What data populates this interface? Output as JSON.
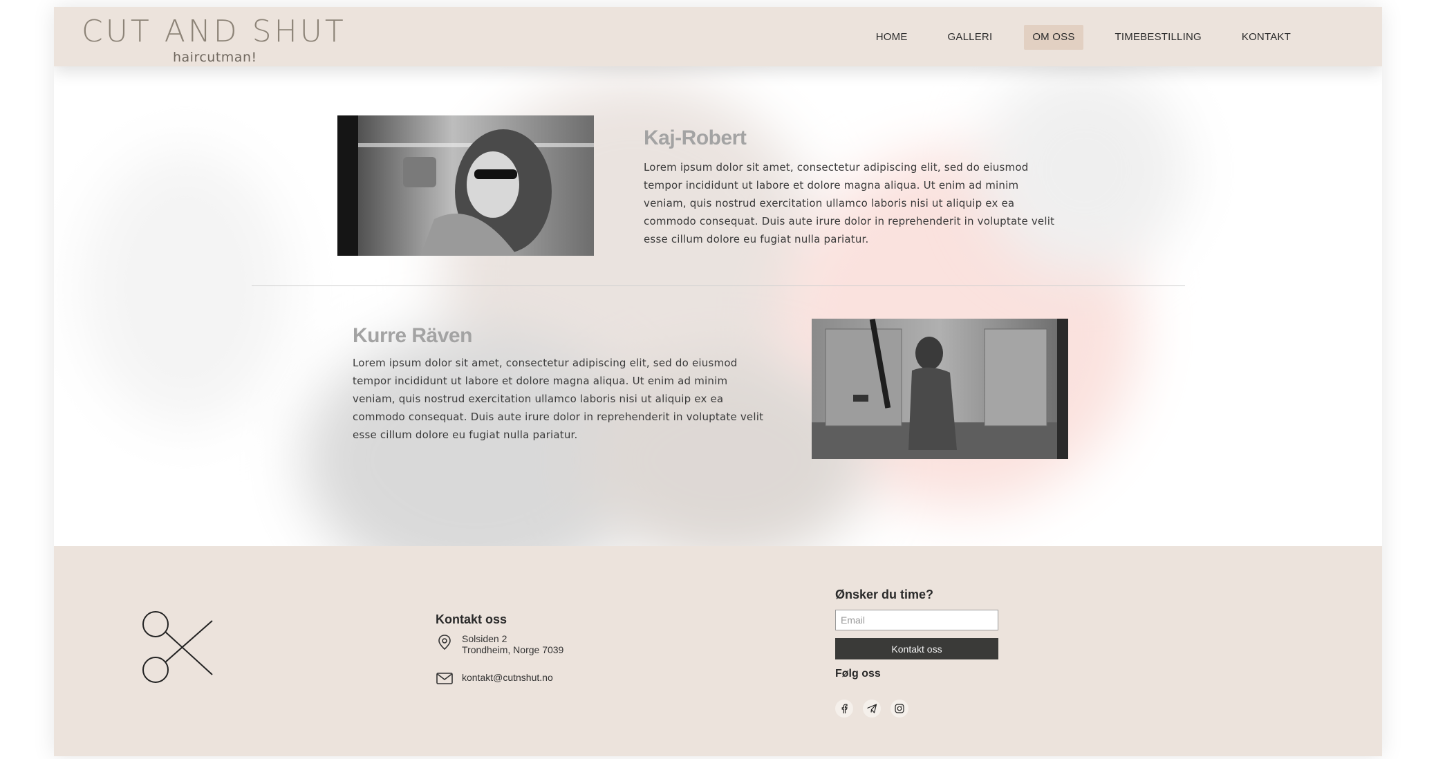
{
  "brand": {
    "title": "CUT AND SHUT",
    "tagline": "haircutman!"
  },
  "nav": {
    "items": [
      {
        "label": "HOME"
      },
      {
        "label": "GALLERI"
      },
      {
        "label": "OM OSS"
      },
      {
        "label": "TIMEBESTILLING"
      },
      {
        "label": "KONTAKT"
      }
    ],
    "active": "OM OSS"
  },
  "profiles": [
    {
      "name": "Kaj-Robert",
      "text": "Lorem ipsum dolor sit amet, consectetur adipiscing elit, sed do eiusmod tempor incididunt ut labore et dolore magna aliqua. Ut enim ad minim veniam, quis nostrud exercitation ullamco laboris nisi ut aliquip ex ea commodo consequat. Duis aute irure dolor in reprehenderit in voluptate velit esse cillum dolore eu fugiat nulla pariatur."
    },
    {
      "name": "Kurre Räven",
      "text": "Lorem ipsum dolor sit amet, consectetur adipiscing elit, sed do eiusmod tempor incididunt ut labore et dolore magna aliqua. Ut enim ad minim veniam, quis nostrud exercitation ullamco laboris nisi ut aliquip ex ea commodo consequat. Duis aute irure dolor in reprehenderit in voluptate velit esse cillum dolore eu fugiat nulla pariatur."
    }
  ],
  "footer": {
    "contact": {
      "title": "Kontakt oss",
      "address_line1": "Solsiden 2",
      "address_line2": "Trondheim, Norge 7039",
      "email": "kontakt@cutnshut.no"
    },
    "booking": {
      "title": "Ønsker du time?",
      "email_placeholder": "Email",
      "button_label": "Kontakt oss",
      "follow_title": "Følg oss",
      "socials": [
        "facebook-icon",
        "telegram-icon",
        "instagram-icon"
      ]
    }
  },
  "colors": {
    "header_bg": "#ece3dc",
    "active_nav_bg": "#e2d0c2",
    "button_bg": "#3a3a38",
    "name_color": "#a3a3a3"
  }
}
